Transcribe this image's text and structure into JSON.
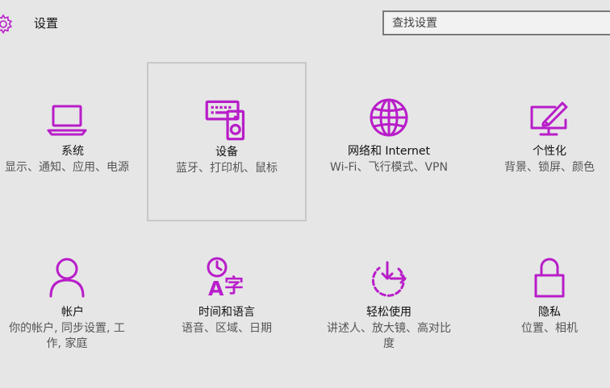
{
  "header": {
    "title": "设置",
    "search_placeholder": "查找设置"
  },
  "tiles": [
    {
      "name": "系统",
      "desc": "显示、通知、应用、电源",
      "icon": "laptop-icon"
    },
    {
      "name": "设备",
      "desc": "蓝牙、打印机、鼠标",
      "icon": "devices-icon"
    },
    {
      "name": "网络和 Internet",
      "desc": "Wi-Fi、飞行模式、VPN",
      "icon": "globe-icon"
    },
    {
      "name": "个性化",
      "desc": "背景、锁屏、颜色",
      "icon": "personalization-icon"
    },
    {
      "name": "帐户",
      "desc": "你的帐户, 同步设置, 工作, 家庭",
      "icon": "person-icon"
    },
    {
      "name": "时间和语言",
      "desc": "语音、区域、日期",
      "icon": "time-language-icon"
    },
    {
      "name": "轻松使用",
      "desc": "讲述人、放大镜、高对比度",
      "icon": "ease-of-access-icon"
    },
    {
      "name": "隐私",
      "desc": "位置、相机",
      "icon": "lock-icon"
    }
  ],
  "colors": {
    "accent": "#b81dc9",
    "background": "#e6e6e6"
  }
}
